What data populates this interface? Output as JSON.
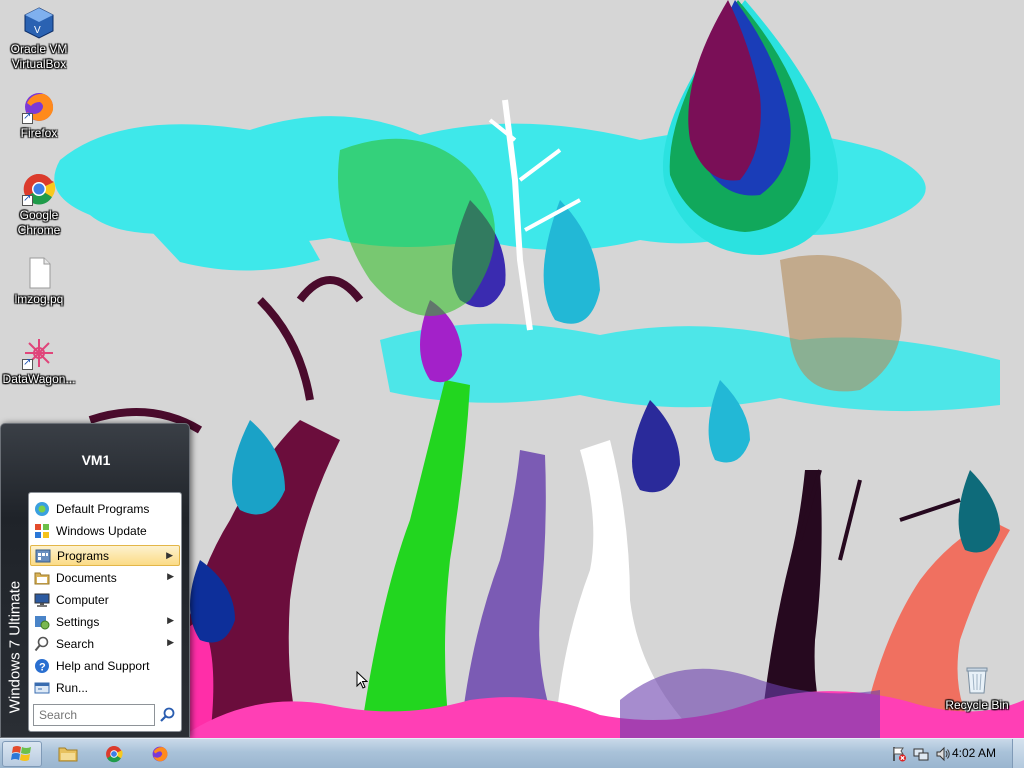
{
  "desktop": {
    "icons": [
      {
        "label": "Oracle VM\nVirtualBox",
        "icon": "virtualbox-icon"
      },
      {
        "label": "Firefox",
        "icon": "firefox-icon"
      },
      {
        "label": "Google\nChrome",
        "icon": "chrome-icon"
      },
      {
        "label": "lmzog.pq",
        "icon": "file-icon"
      },
      {
        "label": "DataWagon...",
        "icon": "datawagon-icon"
      },
      {
        "label": "Recycle Bin",
        "icon": "recycle-bin-icon"
      }
    ]
  },
  "start_menu": {
    "user_name": "VM1",
    "edition": "Windows 7 Ultimate",
    "items": [
      {
        "label": "Default Programs",
        "icon": "default-programs-icon",
        "submenu": false
      },
      {
        "label": "Windows Update",
        "icon": "windows-update-icon",
        "submenu": false
      },
      {
        "label": "Programs",
        "icon": "programs-icon",
        "submenu": true,
        "active": true
      },
      {
        "label": "Documents",
        "icon": "documents-icon",
        "submenu": true
      },
      {
        "label": "Computer",
        "icon": "computer-icon",
        "submenu": false
      },
      {
        "label": "Settings",
        "icon": "settings-icon",
        "submenu": true
      },
      {
        "label": "Search",
        "icon": "search-icon",
        "submenu": true
      },
      {
        "label": "Help and Support",
        "icon": "help-icon",
        "submenu": false
      },
      {
        "label": "Run...",
        "icon": "run-icon",
        "submenu": false
      }
    ],
    "search": {
      "placeholder": "Search",
      "value": ""
    }
  },
  "taskbar": {
    "pinned": [
      {
        "name": "explorer",
        "icon": "folder-icon"
      },
      {
        "name": "chrome",
        "icon": "chrome-icon"
      },
      {
        "name": "firefox",
        "icon": "firefox-icon"
      }
    ],
    "tray": {
      "clock": "4:02 AM",
      "icons": [
        "action-center-icon",
        "network-icon",
        "volume-icon"
      ]
    }
  },
  "colors": {
    "taskbar": "#a9c2d9",
    "start_menu_frame": "#24282e",
    "active_item": "#fbdb86",
    "wallpaper_bg": "#d6d6d6",
    "cloud": "#3ee8ea"
  }
}
